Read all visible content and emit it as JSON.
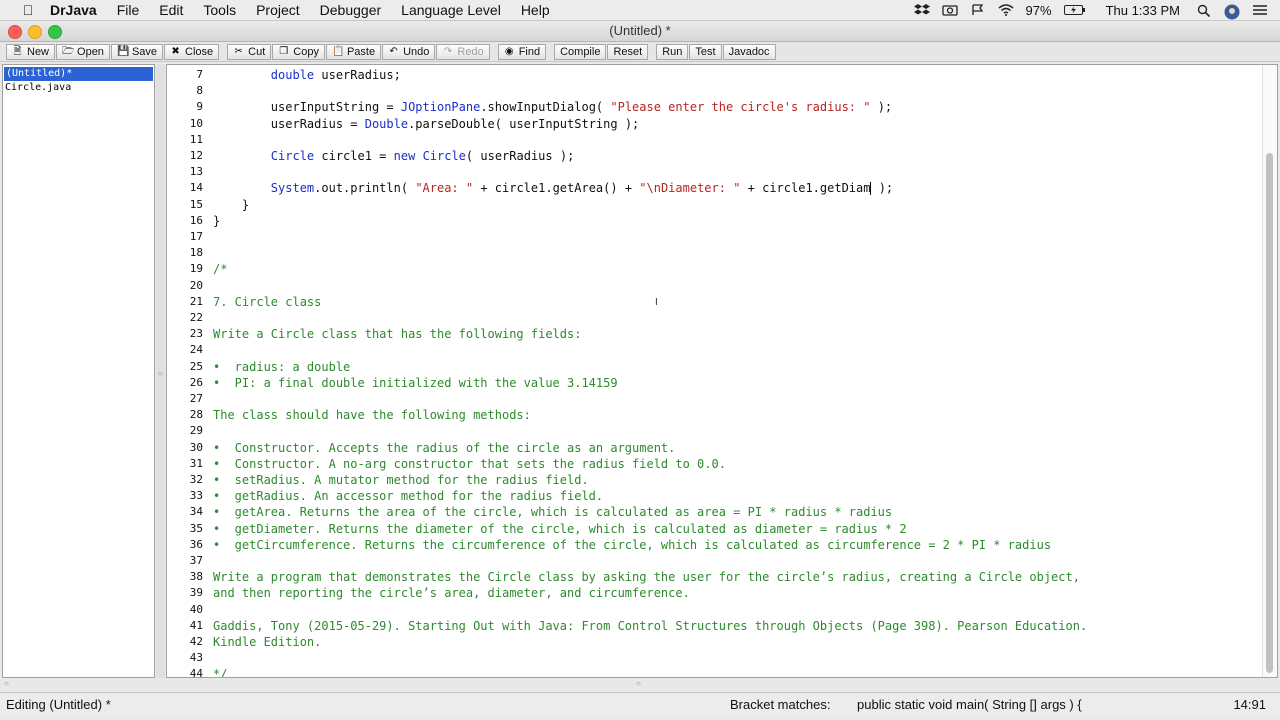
{
  "menubar": {
    "app_name": "DrJava",
    "items": [
      "File",
      "Edit",
      "Tools",
      "Project",
      "Debugger",
      "Language Level",
      "Help"
    ],
    "battery": "97%",
    "clock": "Thu 1:33 PM"
  },
  "window": {
    "title": "(Untitled) *"
  },
  "toolbar": {
    "new": "New",
    "open": "Open",
    "save": "Save",
    "close": "Close",
    "cut": "Cut",
    "copy": "Copy",
    "paste": "Paste",
    "undo": "Undo",
    "redo": "Redo",
    "find": "Find",
    "compile": "Compile",
    "reset": "Reset",
    "run": "Run",
    "test": "Test",
    "javadoc": "Javadoc"
  },
  "files": [
    "(Untitled)*",
    "Circle.java"
  ],
  "editor": {
    "lines": [
      {
        "n": "7",
        "text": "        double userRadius;"
      },
      {
        "n": "8",
        "text": ""
      },
      {
        "n": "9",
        "text": "        userInputString = JOptionPane.showInputDialog( \"Please enter the circle's radius: \" );"
      },
      {
        "n": "10",
        "text": "        userRadius = Double.parseDouble( userInputString );"
      },
      {
        "n": "11",
        "text": ""
      },
      {
        "n": "12",
        "text": "        Circle circle1 = new Circle( userRadius );"
      },
      {
        "n": "13",
        "text": ""
      },
      {
        "n": "14",
        "text": "        System.out.println( \"Area: \" + circle1.getArea() + \"\\nDiameter: \" + circle1.getDiam );"
      },
      {
        "n": "15",
        "text": "    }"
      },
      {
        "n": "16",
        "text": "}"
      },
      {
        "n": "17",
        "text": ""
      },
      {
        "n": "18",
        "text": ""
      },
      {
        "n": "19",
        "text": "/*"
      },
      {
        "n": "20",
        "text": ""
      },
      {
        "n": "21",
        "text": "7. Circle class"
      },
      {
        "n": "22",
        "text": ""
      },
      {
        "n": "23",
        "text": "Write a Circle class that has the following fields:"
      },
      {
        "n": "24",
        "text": ""
      },
      {
        "n": "25",
        "text": "•  radius: a double"
      },
      {
        "n": "26",
        "text": "•  PI: a final double initialized with the value 3.14159"
      },
      {
        "n": "27",
        "text": ""
      },
      {
        "n": "28",
        "text": "The class should have the following methods:"
      },
      {
        "n": "29",
        "text": ""
      },
      {
        "n": "30",
        "text": "•  Constructor. Accepts the radius of the circle as an argument."
      },
      {
        "n": "31",
        "text": "•  Constructor. A no-arg constructor that sets the radius field to 0.0."
      },
      {
        "n": "32",
        "text": "•  setRadius. A mutator method for the radius field."
      },
      {
        "n": "33",
        "text": "•  getRadius. An accessor method for the radius field."
      },
      {
        "n": "34",
        "text": "•  getArea. Returns the area of the circle, which is calculated as area = PI * radius * radius"
      },
      {
        "n": "35",
        "text": "•  getDiameter. Returns the diameter of the circle, which is calculated as diameter = radius * 2"
      },
      {
        "n": "36",
        "text": "•  getCircumference. Returns the circumference of the circle, which is calculated as circumference = 2 * PI * radius"
      },
      {
        "n": "37",
        "text": ""
      },
      {
        "n": "38",
        "text": "Write a program that demonstrates the Circle class by asking the user for the circle’s radius, creating a Circle object,"
      },
      {
        "n": "39",
        "text": "and then reporting the circle’s area, diameter, and circumference."
      },
      {
        "n": "40",
        "text": ""
      },
      {
        "n": "41",
        "text": "Gaddis, Tony (2015-05-29). Starting Out with Java: From Control Structures through Objects (Page 398). Pearson Education."
      },
      {
        "n": "42",
        "text": "Kindle Edition."
      },
      {
        "n": "43",
        "text": ""
      },
      {
        "n": "44",
        "text": "*/"
      }
    ]
  },
  "status": {
    "mode": "Editing (Untitled) *",
    "bracket_label": "Bracket matches:",
    "bracket_value": "public static void main( String [] args ) {",
    "position": "14:91"
  },
  "colors": {
    "keyword": "#1a2fc7",
    "string": "#b5261f",
    "comment": "#2d8a2d",
    "selection": "#2b63d6"
  }
}
